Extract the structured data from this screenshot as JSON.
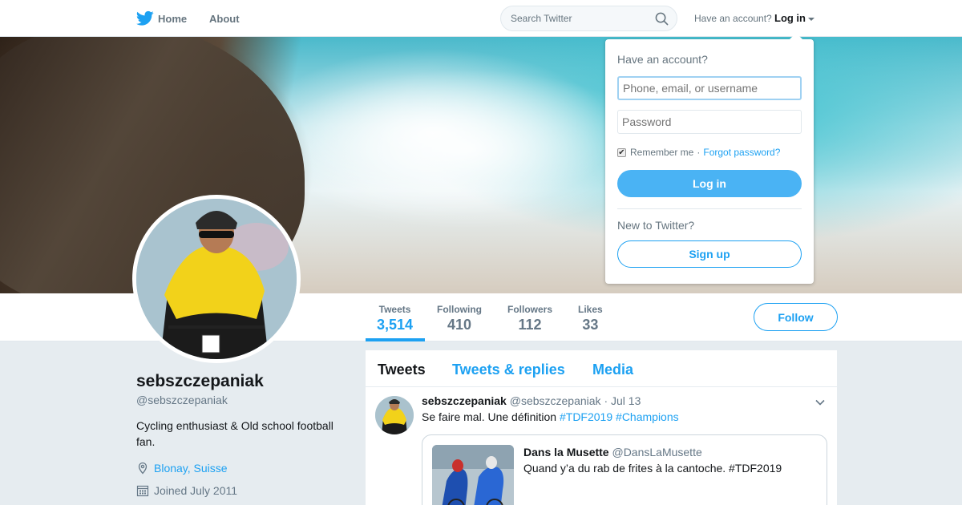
{
  "nav": {
    "home_label": "Home",
    "about_label": "About",
    "search_placeholder": "Search Twitter",
    "have_account": "Have an account?",
    "login_label": "Log in",
    "brand_color": "#1da1f2"
  },
  "profile": {
    "name": "sebszczepaniak",
    "handle": "@sebszczepaniak",
    "bio": "Cycling enthusiast & Old school football fan.",
    "location": "Blonay, Suisse",
    "joined": "Joined July 2011",
    "follow_label": "Follow"
  },
  "stats": [
    {
      "label": "Tweets",
      "value": "3,514"
    },
    {
      "label": "Following",
      "value": "410"
    },
    {
      "label": "Followers",
      "value": "112"
    },
    {
      "label": "Likes",
      "value": "33"
    }
  ],
  "timeline": {
    "tabs": [
      "Tweets",
      "Tweets & replies",
      "Media"
    ],
    "tweet": {
      "author_name": "sebszczepaniak",
      "author_handle": "@sebszczepaniak",
      "separator": "·",
      "date": "Jul 13",
      "text": "Se faire mal. Une définition",
      "hashtags": [
        "#TDF2019",
        "#Champions"
      ],
      "quote": {
        "author_name": "Dans la Musette",
        "author_handle": "@DansLaMusette",
        "text": "Quand y’a du rab de frites à la cantoche. #TDF2019"
      }
    }
  },
  "login_dropdown": {
    "title": "Have an account?",
    "username_placeholder": "Phone, email, or username",
    "password_placeholder": "Password",
    "remember_label": "Remember me",
    "separator": "·",
    "forgot_label": "Forgot password?",
    "login_button": "Log in",
    "new_label": "New to Twitter?",
    "signup_button": "Sign up"
  }
}
